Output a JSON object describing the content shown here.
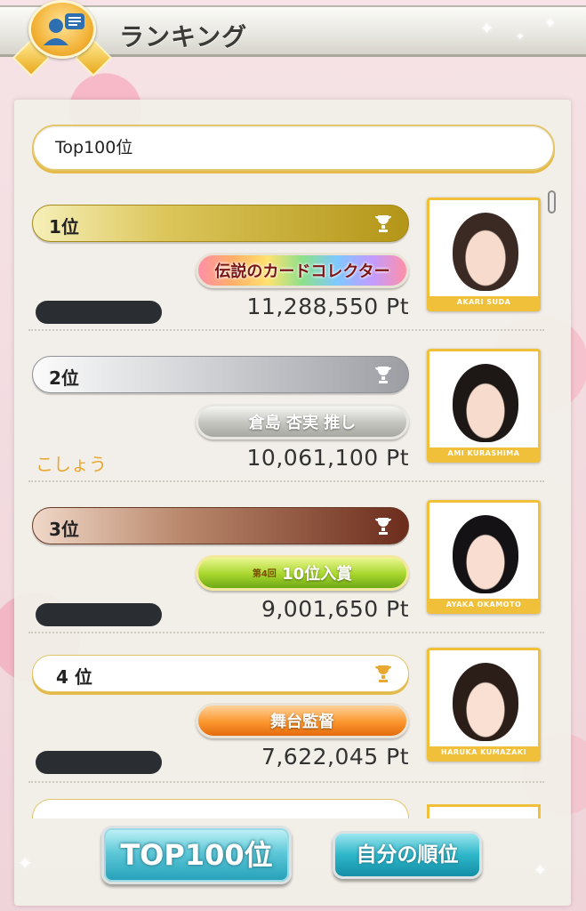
{
  "header": {
    "title": "ランキング",
    "icon": "ranking-people-icon"
  },
  "filter": {
    "value": "Top100位"
  },
  "rows": [
    {
      "rank": "1位",
      "bar_style": "gold",
      "title": "伝説のカードコレクター",
      "title_style": "rainbow",
      "user_name": null,
      "points": "11,288,550 Pt",
      "photo_name": "AKARI SUDA"
    },
    {
      "rank": "2位",
      "bar_style": "silver",
      "title": "倉島 杏実 推し",
      "title_style": "silver",
      "user_name": "こしょう",
      "points": "10,061,100 Pt",
      "photo_name": "AMI KURASHIMA"
    },
    {
      "rank": "3位",
      "bar_style": "bronze",
      "title": "10位入賞",
      "title_prefix": "第4回",
      "title_style": "green",
      "user_name": null,
      "points": "9,001,650 Pt",
      "photo_name": "AYAKA OKAMOTO"
    },
    {
      "rank": "4 位",
      "bar_style": "white",
      "title": "舞台監督",
      "title_style": "orange",
      "user_name": null,
      "points": "7,622,045 Pt",
      "photo_name": "HARUKA KUMAZAKI"
    }
  ],
  "buttons": {
    "top100": "TOP100位",
    "my_rank": "自分の順位"
  },
  "colors": {
    "accent_gold": "#f0c03a",
    "name_color": "#e8a832",
    "button_teal": "#2eb6c9"
  }
}
